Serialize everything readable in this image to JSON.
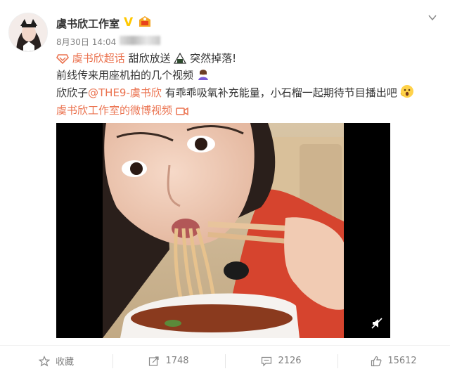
{
  "post": {
    "author": "虞书欣工作室",
    "date": "8月30日 14:04",
    "lines": {
      "l1_topic": "虞书欣超话",
      "l1_text": "甜欣放送",
      "l1_text2": "突然掉落!",
      "l2_text": "前线传来用座机拍的几个视频",
      "l3_prefix": "欣欣子",
      "l3_mention": "@THE9-虞书欣",
      "l3_text": "有乖乖吸氧补充能量，小石榴一起期待节目播出吧",
      "l4_link": "虞书欣工作室的微博视频"
    }
  },
  "actions": {
    "favorite": "收藏",
    "repost": "1748",
    "comment": "2126",
    "like": "15612"
  },
  "colors": {
    "link": "#eb7350",
    "verified": "#ffc800"
  }
}
